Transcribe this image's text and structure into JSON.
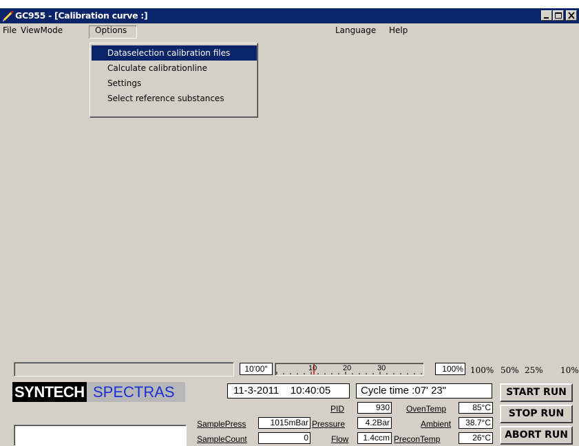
{
  "window": {
    "title": "GC955 - [Calibration curve :]"
  },
  "menubar": {
    "items": [
      "File",
      "ViewMode",
      "Options",
      "Language",
      "Help"
    ]
  },
  "options_menu": {
    "items": [
      "Dataselection calibration files",
      "Calculate calibrationline",
      "Settings",
      "Select reference substances"
    ],
    "highlighted_index": 0
  },
  "timeline": {
    "time_label": "10'00\"",
    "ticks": [
      "10",
      "20",
      "30"
    ],
    "zoom_value": "100%",
    "zoom_options": [
      "100%",
      "50%",
      "25%",
      "10%"
    ]
  },
  "brand": {
    "left": "SYNTECH",
    "right": "SPECTRAS"
  },
  "datetime": {
    "date": "11-3-2011",
    "time": "10:40:05"
  },
  "cycle_time": "Cycle time :07' 23\"",
  "readings": {
    "sample_press_label": "SamplePress",
    "sample_press_value": "1015mBar",
    "sample_count_label": "SampleCount",
    "sample_count_value": "0",
    "pid_label": "PID",
    "pid_value": "930",
    "pressure_label": "Pressure",
    "pressure_value": "4.2Bar",
    "flow_label": "Flow",
    "flow_value": "1.4ccm",
    "oven_temp_label": "OvenTemp",
    "oven_temp_value": "85°C",
    "ambient_label": "Ambient",
    "ambient_value": "38.7°C",
    "precon_temp_label": "PreconTemp",
    "precon_temp_value": "26°C"
  },
  "buttons": {
    "start": "START RUN",
    "stop": "STOP RUN",
    "abort": "ABORT RUN"
  },
  "colors": {
    "titlebar": "#0a246a",
    "highlight": "#0a246a",
    "spectras": "#1a2fd6",
    "face": "#d4d0c8"
  }
}
